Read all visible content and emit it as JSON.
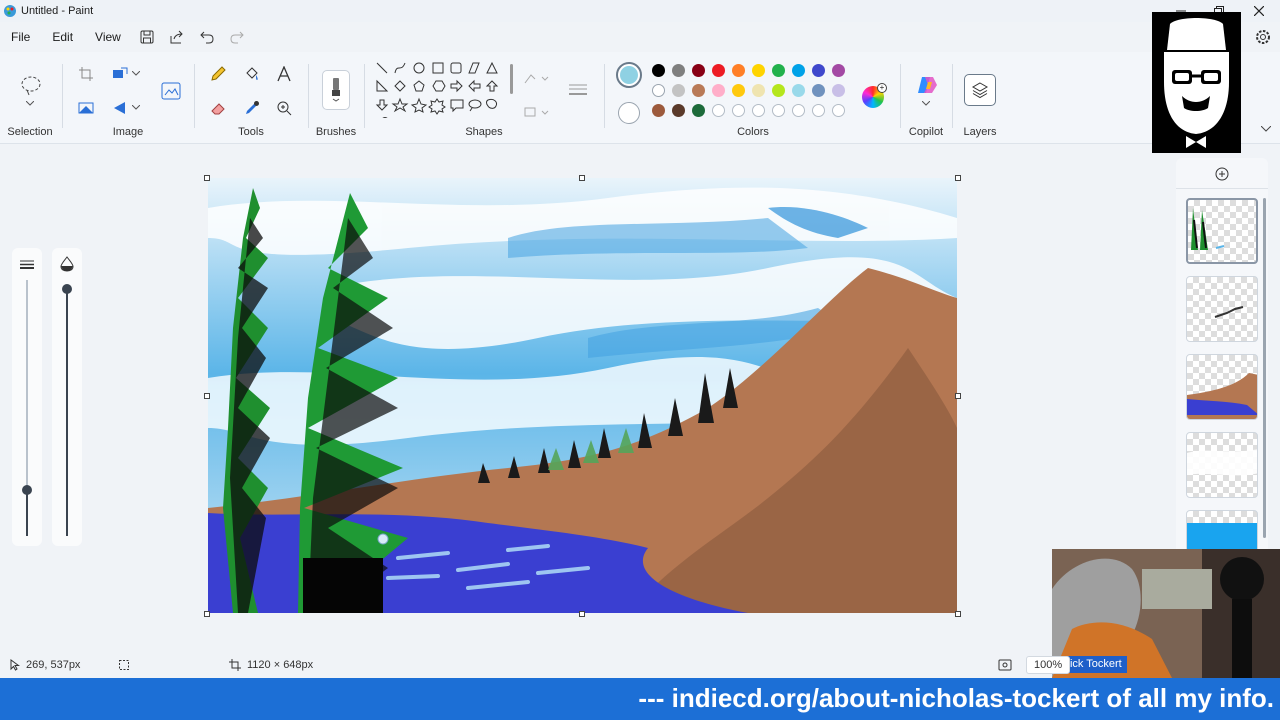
{
  "window": {
    "title": "Untitled - Paint"
  },
  "menu": {
    "file": "File",
    "edit": "Edit",
    "view": "View"
  },
  "ribbon": {
    "groups": {
      "selection": "Selection",
      "image": "Image",
      "tools": "Tools",
      "brushes": "Brushes",
      "shapes": "Shapes",
      "colors": "Colors",
      "copilot": "Copilot",
      "layers": "Layers"
    },
    "primary_color": "#8fd1e3",
    "secondary_color": "#ffffff",
    "palette_row1": [
      "#000000",
      "#7f7f7f",
      "#880015",
      "#ed1c24",
      "#ff7f27",
      "#ffd400",
      "#22b14c",
      "#00a2e8",
      "#3f48cc",
      "#a349a4"
    ],
    "palette_row2": [
      "#ffffff",
      "#c3c3c3",
      "#b97a57",
      "#ffaec9",
      "#ffc90e",
      "#efe4b0",
      "#b5e61d",
      "#99d9ea",
      "#7092be",
      "#c8bfe7"
    ],
    "palette_row3": [
      "#9c5a3c",
      "#5a3a2a",
      "#1d6b3a"
    ]
  },
  "status": {
    "cursor_position": "269, 537px",
    "canvas_size": "1120 × 648px",
    "zoom": "100%"
  },
  "overlay": {
    "name_tag": "Nick Tockert",
    "ticker": "--- indiecd.org/about-nicholas-tockert of all my info."
  }
}
